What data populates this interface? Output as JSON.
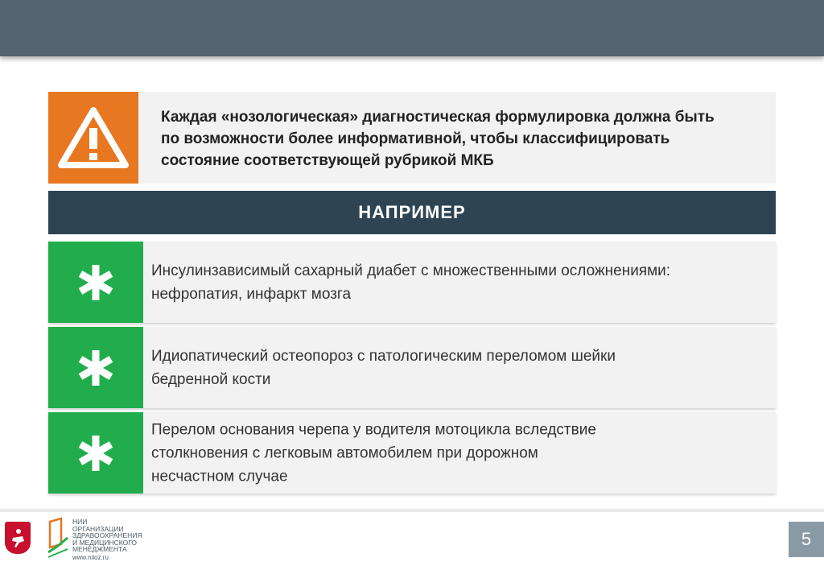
{
  "warning": {
    "lines": [
      "Каждая «нозологическая» диагностическая формулировка должна быть",
      "по возможности более информативной, чтобы классифицировать",
      "состояние соответствующей  рубрикой МКБ"
    ],
    "icon": "warning-triangle-icon",
    "color": "#e87722"
  },
  "example": {
    "header": "НАПРИМЕР",
    "color": "#2e4452"
  },
  "items": [
    {
      "icon": "asterisk-icon",
      "lines": [
        "Инсулинзависимый сахарный диабет с множественными осложнениями:",
        "нефропатия, инфаркт мозга"
      ]
    },
    {
      "icon": "asterisk-icon",
      "lines": [
        "Идиопатический остеопороз с патологическим переломом шейки",
        "бедренной кости"
      ]
    },
    {
      "icon": "asterisk-icon",
      "lines": [
        "Перелом основания черепа у водителя мотоцикла вследствие",
        "столкновения с легковым автомобилем при дорожном",
        "несчастном случае"
      ]
    }
  ],
  "item_color": "#22ad4c",
  "footer": {
    "logo_lines": [
      "НИИ",
      "ОРГАНИЗАЦИИ",
      "ЗДРАВООХРАНЕНИЯ",
      "И МЕДИЦИНСКОГО",
      "МЕНЕДЖМЕНТА"
    ],
    "logo_url": "www.niioz.ru",
    "page_number": "5"
  }
}
